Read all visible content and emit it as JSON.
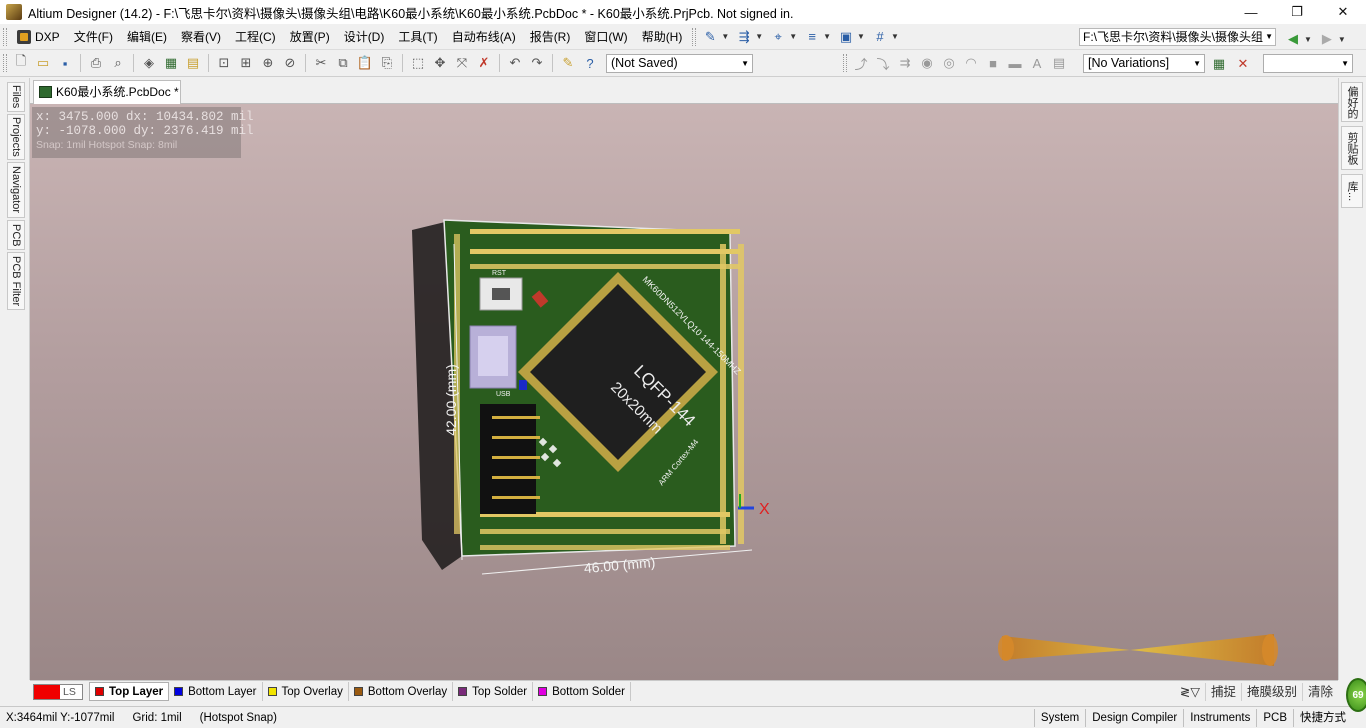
{
  "window": {
    "title": "Altium Designer (14.2) - F:\\飞思卡尔\\资料\\摄像头\\摄像头组\\电路\\K60最小系统\\K60最小系统.PcbDoc * - K60最小系统.PrjPcb. Not signed in.",
    "minimize": "—",
    "restore": "❐",
    "close": "✕"
  },
  "menu": {
    "dxp": "DXP",
    "items": [
      "文件(F)",
      "编辑(E)",
      "察看(V)",
      "工程(C)",
      "放置(P)",
      "设计(D)",
      "工具(T)",
      "自动布线(A)",
      "报告(R)",
      "窗口(W)",
      "帮助(H)"
    ],
    "path_combo": "F:\\飞思卡尔\\资料\\摄像头\\摄像头组",
    "nav_back": "back-arrow-icon",
    "nav_forward": "forward-arrow-icon"
  },
  "toolbar": {
    "saved_combo": "(Not Saved)",
    "variations_combo": "[No Variations]",
    "blank_combo": ""
  },
  "left_panels": [
    "Files",
    "Projects",
    "Navigator",
    "PCB",
    "PCB Filter"
  ],
  "right_panels": [
    "偏好的",
    "剪贴板",
    "库..."
  ],
  "document": {
    "tab_label": "K60最小系统.PcbDoc *"
  },
  "hud": {
    "line1": "x:  3475.000   dx: 10434.802  mil",
    "line2": "y: -1078.000   dy:  2376.419  mil",
    "snap": "Snap: 1mil Hotspot Snap: 8mil"
  },
  "board": {
    "chip_line1": "LQFP-144",
    "chip_line2": "20x20mm",
    "chip_ref": "MK60DN512VLQ10 144-150MHZ",
    "core_label": "ARM Cortex-M4",
    "usb_label": "USB",
    "rst_label": "RST",
    "width_dim": "46.00 (mm)",
    "height_dim": "42.00 (mm)",
    "axis_x": "X"
  },
  "layers": {
    "ls_label": "LS",
    "tabs": [
      {
        "name": "Top Layer",
        "color": "#e00000"
      },
      {
        "name": "Bottom Layer",
        "color": "#0000e0"
      },
      {
        "name": "Top Overlay",
        "color": "#f2e400"
      },
      {
        "name": "Bottom Overlay",
        "color": "#9a5a10"
      },
      {
        "name": "Top Solder",
        "color": "#7a2a7a"
      },
      {
        "name": "Bottom Solder",
        "color": "#e000e0"
      }
    ],
    "right": [
      "捕捉",
      "掩膜级别",
      "清除"
    ]
  },
  "status": {
    "coords": "X:3464mil Y:-1077mil",
    "grid": "Grid: 1mil",
    "snap": "(Hotspot Snap)",
    "buttons": [
      "System",
      "Design Compiler",
      "Instruments",
      "PCB",
      "快捷方式"
    ],
    "badge": "69"
  }
}
